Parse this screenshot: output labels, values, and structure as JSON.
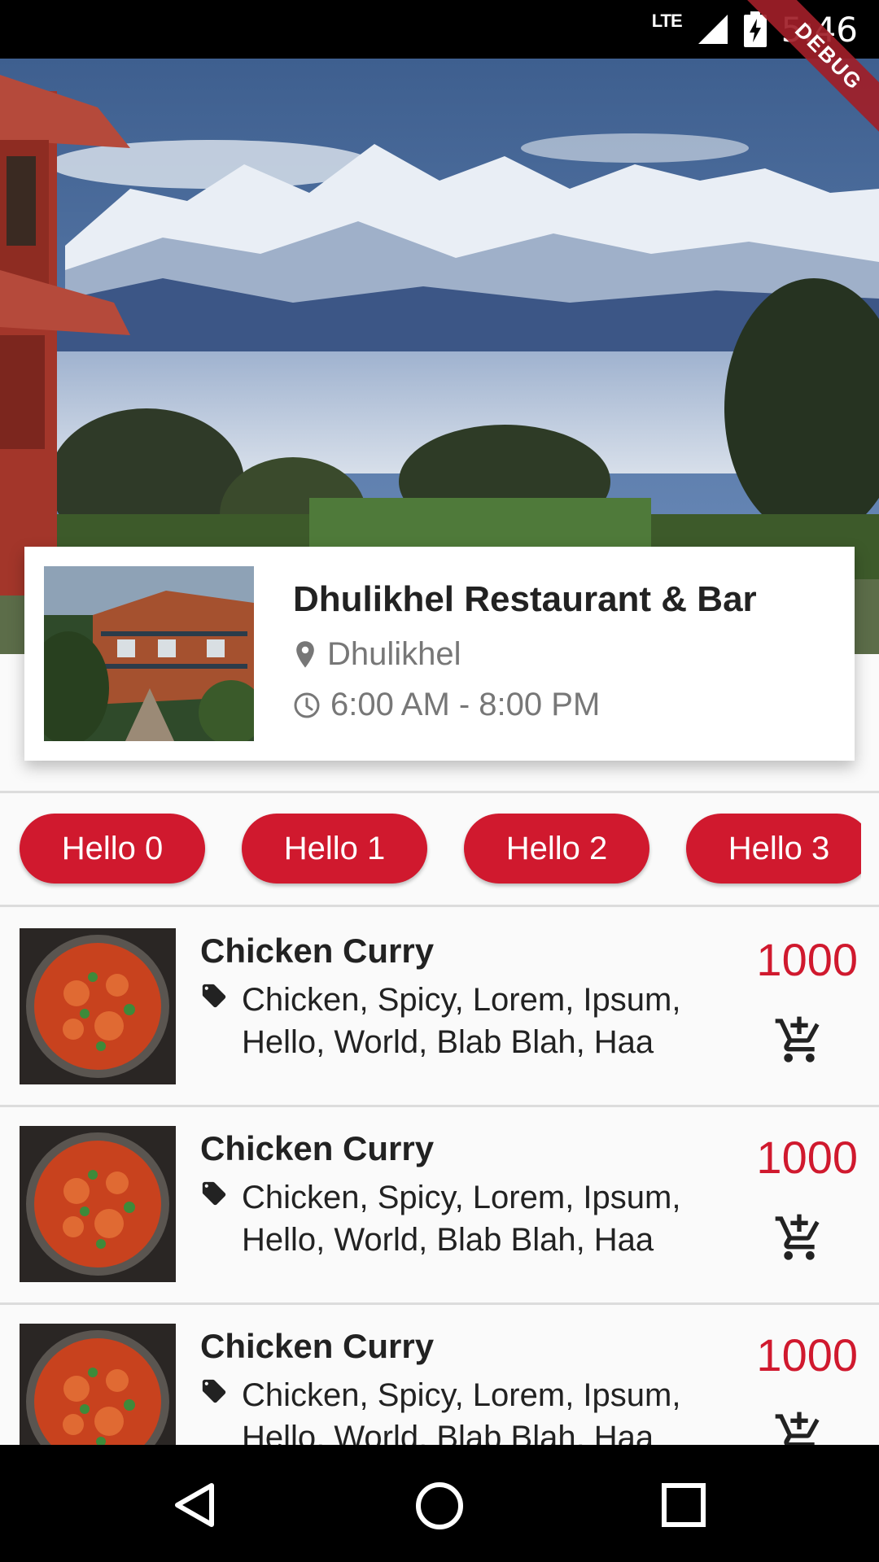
{
  "status_bar": {
    "network": "LTE",
    "time": "5:46"
  },
  "debug_banner": "DEBUG",
  "restaurant": {
    "name": "Dhulikhel Restaurant & Bar",
    "location": "Dhulikhel",
    "hours": "6:00 AM - 8:00 PM"
  },
  "chips": [
    {
      "label": "Hello 0"
    },
    {
      "label": "Hello 1"
    },
    {
      "label": "Hello 2"
    },
    {
      "label": "Hello 3"
    }
  ],
  "menu_items": [
    {
      "name": "Chicken Curry",
      "tags": "Chicken, Spicy, Lorem, Ipsum, Hello, World, Blab Blah, Haa",
      "price": "1000"
    },
    {
      "name": "Chicken Curry",
      "tags": "Chicken, Spicy, Lorem, Ipsum, Hello, World, Blab Blah, Haa",
      "price": "1000"
    },
    {
      "name": "Chicken Curry",
      "tags": "Chicken, Spicy, Lorem, Ipsum, Hello, World, Blab Blah, Haa",
      "price": "1000"
    }
  ],
  "colors": {
    "accent": "#d0192e",
    "text": "#222222",
    "muted": "#777777"
  },
  "icons": {
    "location": "location-pin-icon",
    "clock": "clock-icon",
    "tag": "tag-icon",
    "cart": "add-to-cart-icon",
    "nav": [
      "back-icon",
      "home-icon",
      "recents-icon"
    ]
  }
}
